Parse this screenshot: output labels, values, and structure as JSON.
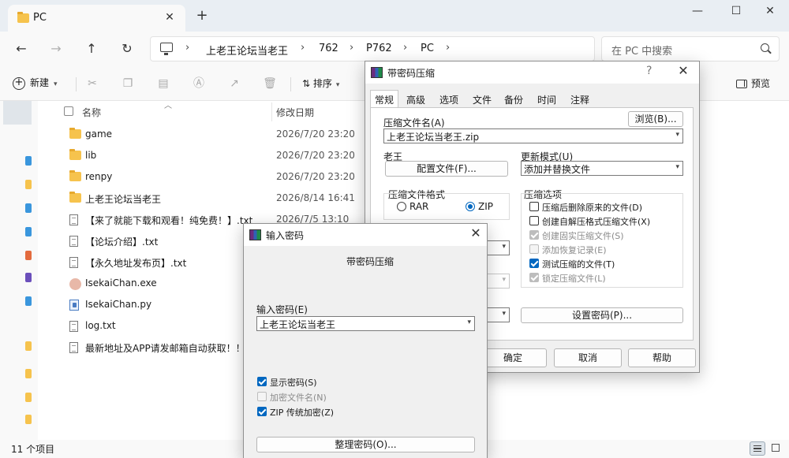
{
  "explorer": {
    "tab_title": "PC",
    "breadcrumb": [
      "上老王论坛当老王",
      "762",
      "P762",
      "PC"
    ],
    "search_placeholder": "在 PC 中搜索",
    "toolbar": {
      "new_label": "新建",
      "sort_label": "排序",
      "preview_label": "预览"
    },
    "columns": {
      "name": "名称",
      "date": "修改日期"
    },
    "files": [
      {
        "name": "game",
        "date": "2026/7/20 23:20",
        "icon": "folder-icon"
      },
      {
        "name": "lib",
        "date": "2026/7/20 23:20",
        "icon": "folder-icon"
      },
      {
        "name": "renpy",
        "date": "2026/7/20 23:20",
        "icon": "folder-icon"
      },
      {
        "name": "上老王论坛当老王",
        "date": "2026/8/14 16:41",
        "icon": "folder-icon"
      },
      {
        "name": "【来了就能下载和观看！纯免费！】.txt",
        "date": "2026/7/5 13:10",
        "icon": "text-file-icon"
      },
      {
        "name": "【论坛介绍】.txt",
        "date": "",
        "icon": "text-file-icon"
      },
      {
        "name": "【永久地址发布页】.txt",
        "date": "",
        "icon": "text-file-icon"
      },
      {
        "name": "IsekaiChan.exe",
        "date": "",
        "icon": "exe-file-icon"
      },
      {
        "name": "IsekaiChan.py",
        "date": "",
        "icon": "python-file-icon"
      },
      {
        "name": "log.txt",
        "date": "",
        "icon": "text-file-icon"
      },
      {
        "name": "最新地址及APP请发邮箱自动获取！！！",
        "date": "",
        "icon": "text-file-icon"
      }
    ],
    "status": "11 个项目"
  },
  "archive_dialog": {
    "title": "带密码压缩",
    "help": "?",
    "tabs": [
      "常规",
      "高级",
      "选项",
      "文件",
      "备份",
      "时间",
      "注释"
    ],
    "archive_name_label": "压缩文件名(A)",
    "browse_button": "浏览(B)...",
    "archive_name_value": "上老王论坛当老王.zip",
    "profile_label": "老王",
    "profile_button": "配置文件(F)...",
    "update_mode_label": "更新模式(U)",
    "update_mode_value": "添加并替换文件",
    "format_label": "压缩文件格式",
    "format_rar": "RAR",
    "format_zip": "ZIP",
    "options_label": "压缩选项",
    "options": [
      {
        "label": "压缩后删除原来的文件(D)",
        "checked": false,
        "disabled": false
      },
      {
        "label": "创建自解压格式压缩文件(X)",
        "checked": false,
        "disabled": false
      },
      {
        "label": "创建固实压缩文件(S)",
        "checked": true,
        "disabled": true
      },
      {
        "label": "添加恢复记录(E)",
        "checked": false,
        "disabled": true
      },
      {
        "label": "测试压缩的文件(T)",
        "checked": true,
        "disabled": false
      },
      {
        "label": "锁定压缩文件(L)",
        "checked": true,
        "disabled": true
      }
    ],
    "set_password_button": "设置密码(P)...",
    "ok_button": "确定",
    "cancel_button": "取消",
    "help_button": "帮助"
  },
  "password_dialog": {
    "title": "输入密码",
    "heading": "带密码压缩",
    "password_label": "输入密码(E)",
    "password_value": "上老王论坛当老王",
    "show_password": "显示密码(S)",
    "encrypt_names": "加密文件名(N)",
    "zip_legacy": "ZIP 传统加密(Z)",
    "organize_button": "整理密码(O)..."
  }
}
